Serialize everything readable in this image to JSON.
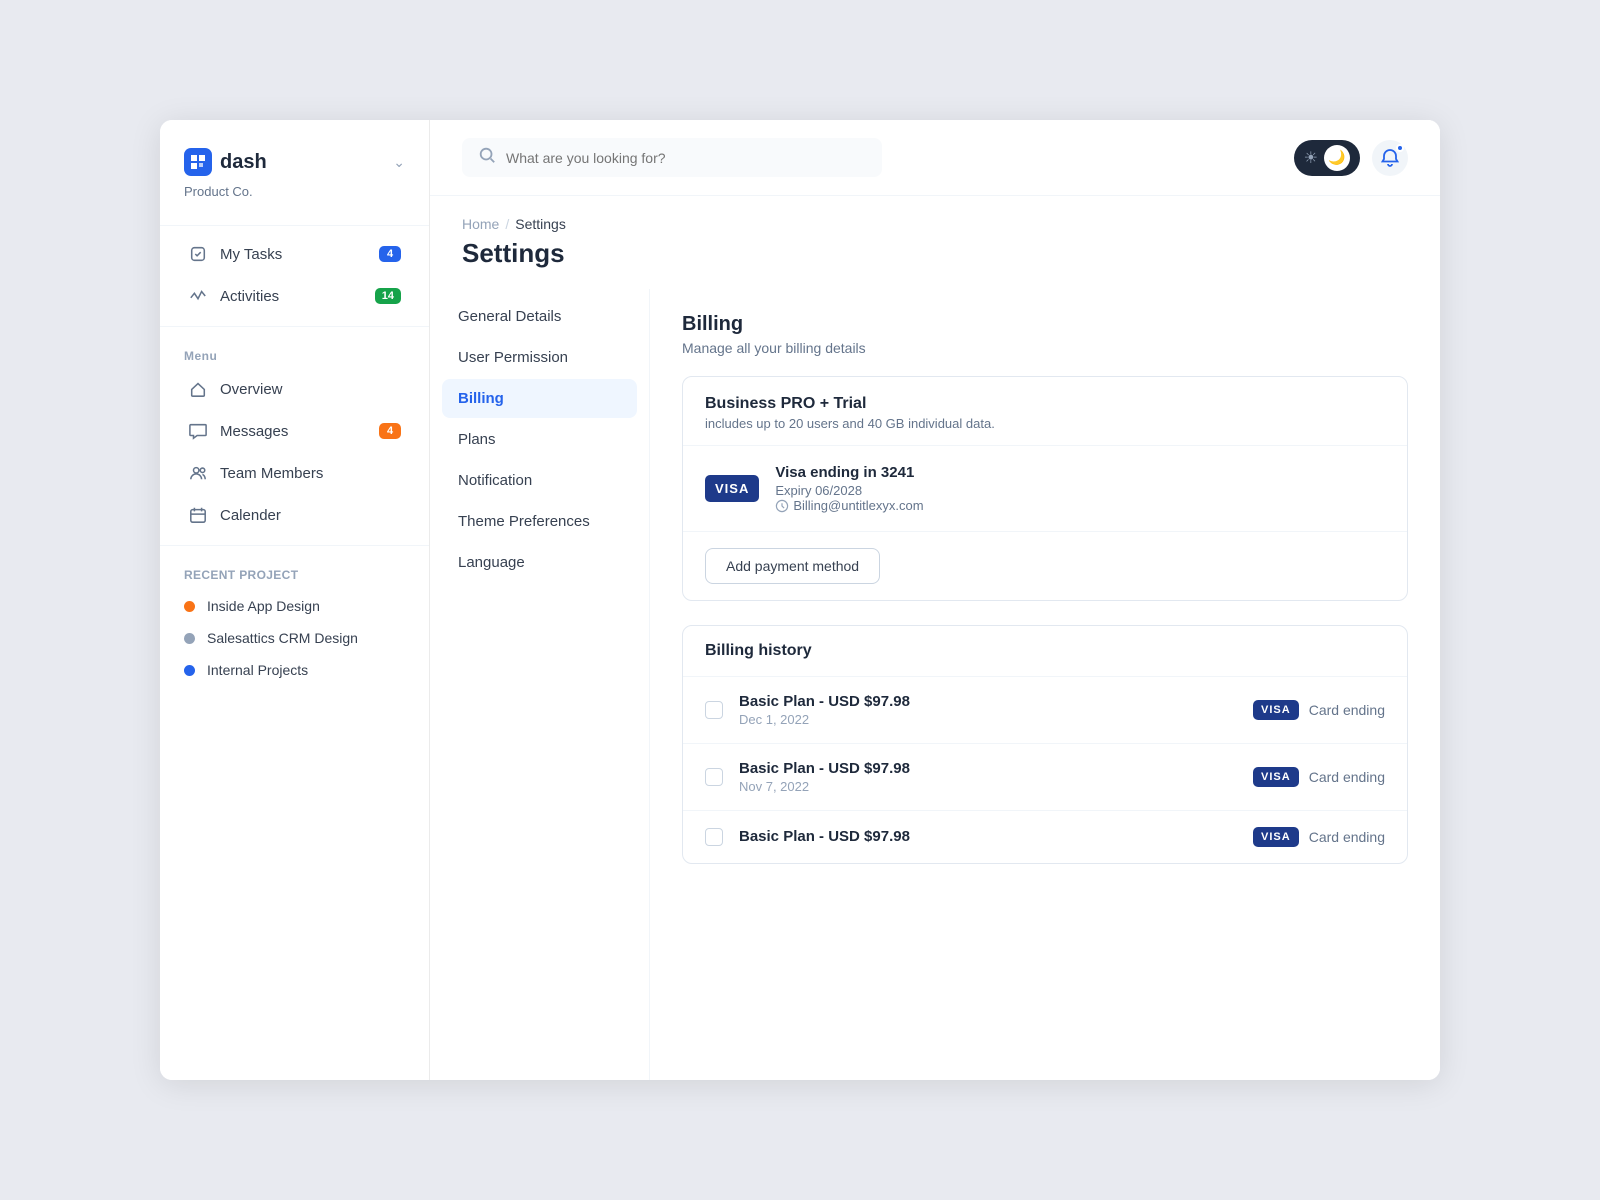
{
  "app": {
    "name": "dash",
    "company": "Product Co."
  },
  "topbar": {
    "search_placeholder": "What are you looking for?"
  },
  "sidebar": {
    "menu_label": "Menu",
    "recent_project_label": "RECENT PROJECT",
    "nav_items": [
      {
        "id": "my-tasks",
        "label": "My Tasks",
        "badge": "4",
        "badge_color": "blue"
      },
      {
        "id": "activities",
        "label": "Activities",
        "badge": "14",
        "badge_color": "green"
      }
    ],
    "menu_items": [
      {
        "id": "overview",
        "label": "Overview"
      },
      {
        "id": "messages",
        "label": "Messages",
        "badge": "4",
        "badge_color": "orange"
      },
      {
        "id": "team-members",
        "label": "Team Members"
      },
      {
        "id": "calender",
        "label": "Calender"
      }
    ],
    "recent_projects": [
      {
        "id": "inside-app",
        "label": "Inside App Design",
        "color": "#f97316"
      },
      {
        "id": "salesattics",
        "label": "Salesattics CRM Design",
        "color": "#94a3b8"
      },
      {
        "id": "internal",
        "label": "Internal Projects",
        "color": "#2563eb"
      }
    ]
  },
  "breadcrumb": {
    "home": "Home",
    "separator": "/",
    "current": "Settings"
  },
  "page": {
    "title": "Settings"
  },
  "settings_nav": {
    "items": [
      {
        "id": "general",
        "label": "General Details"
      },
      {
        "id": "user-permission",
        "label": "User Permission"
      },
      {
        "id": "billing",
        "label": "Billing",
        "active": true
      },
      {
        "id": "plans",
        "label": "Plans"
      },
      {
        "id": "notification",
        "label": "Notification"
      },
      {
        "id": "theme-preferences",
        "label": "Theme Preferences"
      },
      {
        "id": "language",
        "label": "Language"
      }
    ]
  },
  "billing": {
    "title": "Billing",
    "subtitle": "Manage all your billing details",
    "plan": {
      "name": "Business PRO + Trial",
      "description": "includes up to 20 users and 40 GB individual data."
    },
    "payment_method": {
      "card_name": "Visa ending in 3241",
      "expiry": "Expiry 06/2028",
      "email": "Billing@untitlexyx.com"
    },
    "add_payment_label": "Add payment method",
    "history_title": "Billing history",
    "history_rows": [
      {
        "plan": "Basic Plan - USD $97.98",
        "date": "Dec 1, 2022",
        "card": "Card ending"
      },
      {
        "plan": "Basic Plan - USD $97.98",
        "date": "Nov 7, 2022",
        "card": "Card ending"
      },
      {
        "plan": "Basic Plan - USD $97.98",
        "date": "",
        "card": "Card ending"
      }
    ]
  }
}
